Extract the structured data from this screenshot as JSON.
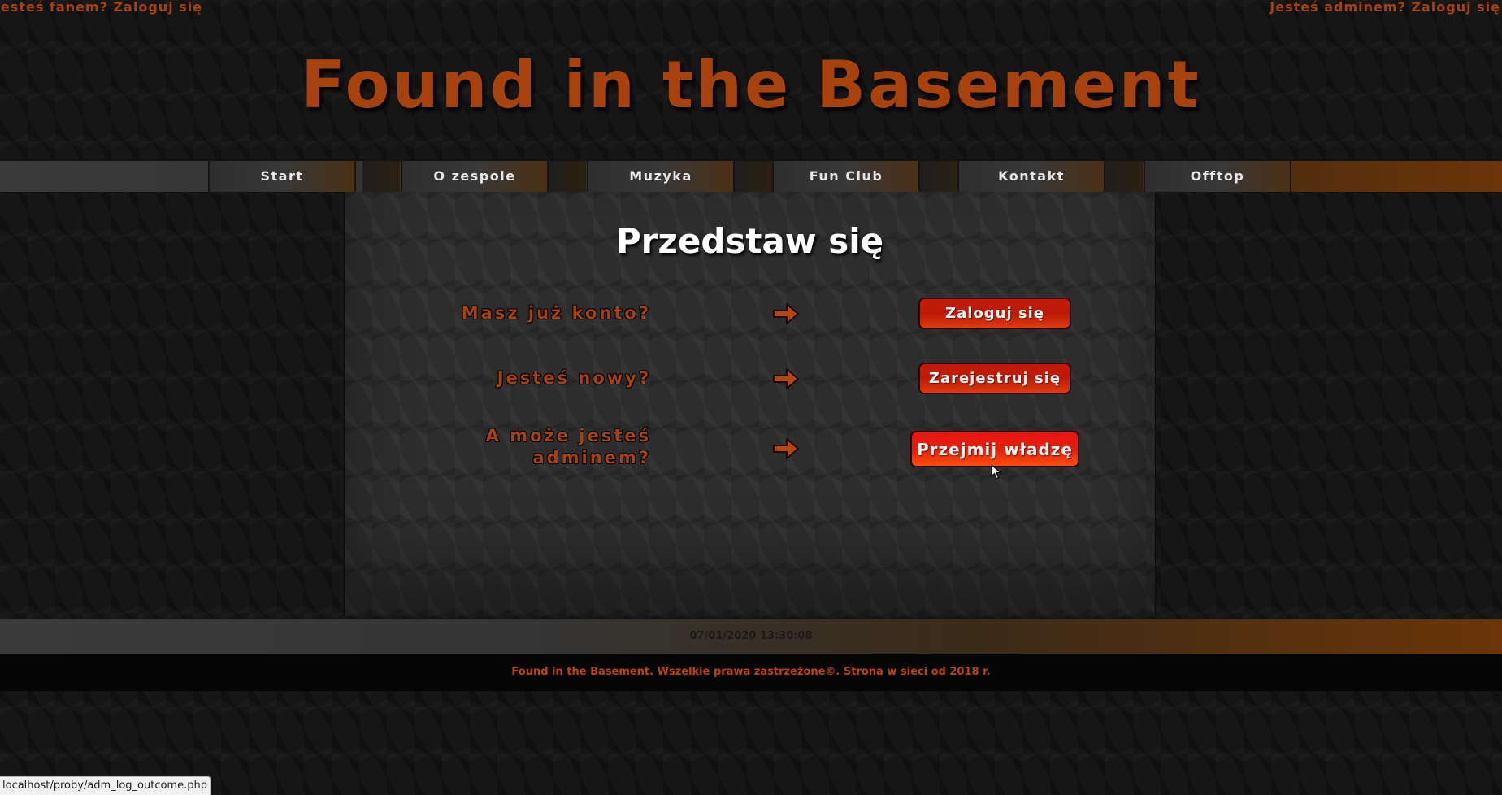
{
  "top_links": {
    "fan_login": "Jesteś fanem? Zaloguj się",
    "admin_login": "Jesteś adminem? Zaloguj się"
  },
  "site": {
    "title": "Found in the Basement"
  },
  "nav": {
    "items": [
      {
        "label": "Start"
      },
      {
        "label": "O zespole"
      },
      {
        "label": "Muzyka"
      },
      {
        "label": "Fun Club"
      },
      {
        "label": "Kontakt"
      },
      {
        "label": "Offtop"
      }
    ]
  },
  "main": {
    "title": "Przedstaw się",
    "rows": [
      {
        "question": "Masz już konto?",
        "button": "Zaloguj się",
        "arrow_icon": "arrow-right-icon"
      },
      {
        "question": "Jesteś nowy?",
        "button": "Zarejestruj się",
        "arrow_icon": "arrow-right-icon"
      },
      {
        "question": "A może jesteś adminem?",
        "button": "Przejmij władzę",
        "arrow_icon": "arrow-right-icon"
      }
    ]
  },
  "date_bar": {
    "datetime": "07/01/2020 13:30:08"
  },
  "footer": {
    "text": "Found in the Basement. Wszelkie prawa zastrzeżone©. Strona w sieci od 2018 r."
  },
  "status_bar": {
    "url": "localhost/proby/adm_log_outcome.php"
  },
  "colors": {
    "accent_orange": "#a8420d",
    "button_red": "#c61a0a",
    "background": "#161616"
  }
}
